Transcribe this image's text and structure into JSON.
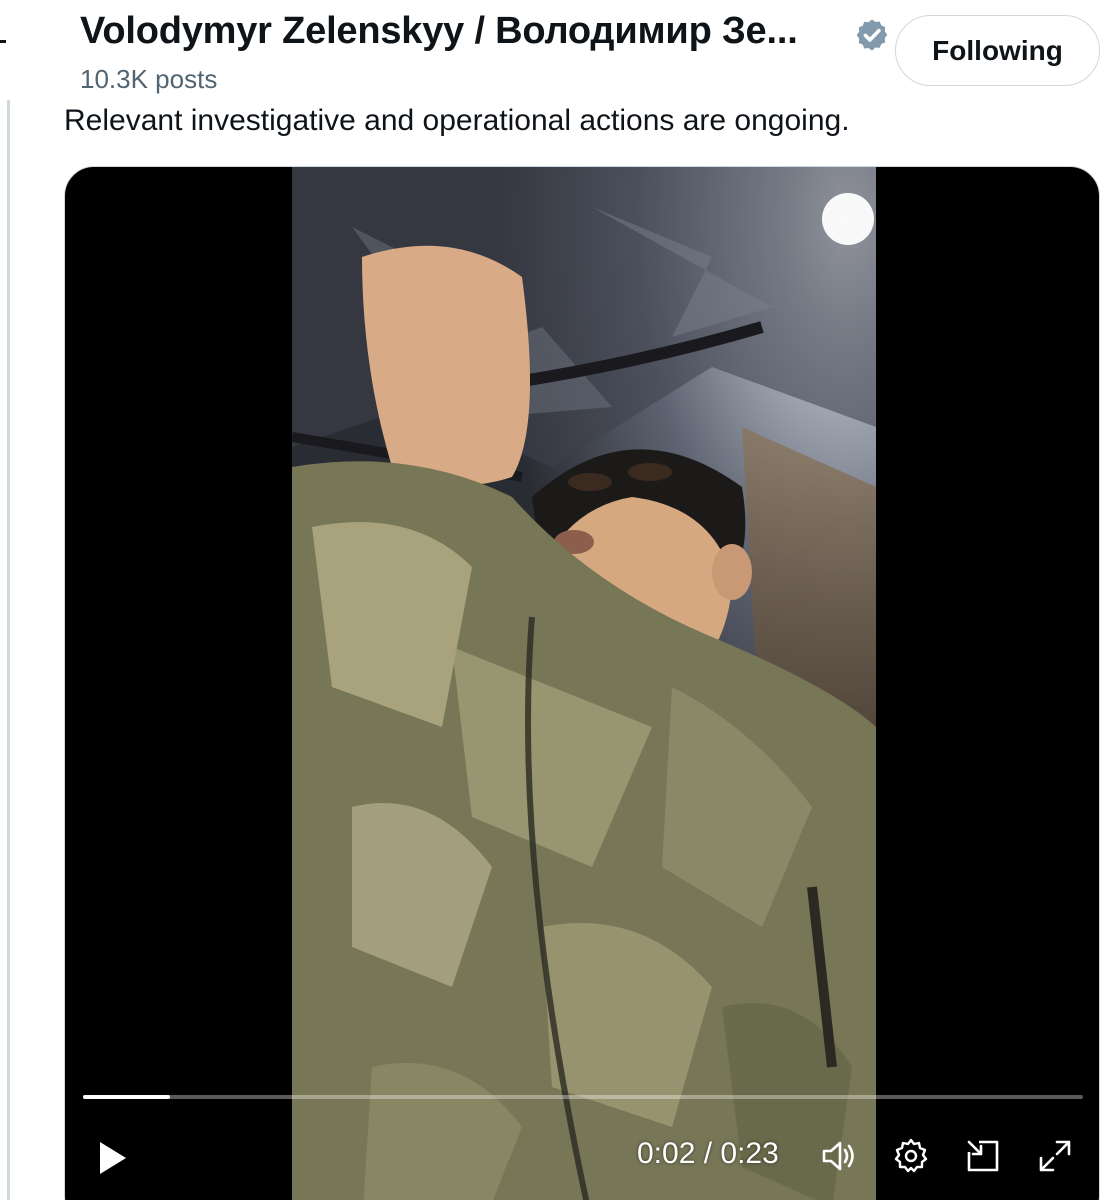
{
  "author": {
    "display_name": "Volodymyr Zelenskyy / Володимир Зе...",
    "post_count": "10.3K posts",
    "verified_icon": "verified-badge-icon",
    "follow_label": "Following"
  },
  "tweet": {
    "text": "Relevant investigative and operational actions are ongoing."
  },
  "video": {
    "current_time": "0:02",
    "duration": "0:23",
    "time_display": "0:02 / 0:23",
    "progress_fraction": 0.087,
    "controls": {
      "play_icon": "play-icon",
      "volume_icon": "volume-icon",
      "settings_icon": "gear-icon",
      "pip_icon": "picture-in-picture-icon",
      "fullscreen_icon": "fullscreen-icon"
    }
  },
  "colors": {
    "text_primary": "#0f1419",
    "text_secondary": "#536471",
    "verified_badge": "#829aab",
    "border": "#cfd9de",
    "video_background": "#000000"
  }
}
